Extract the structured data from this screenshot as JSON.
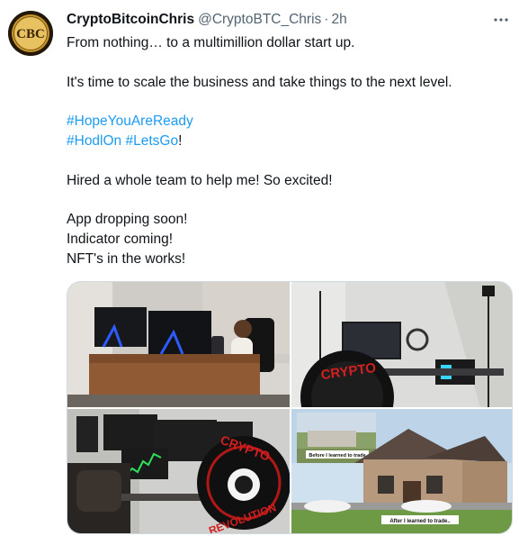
{
  "tweet": {
    "display_name": "CryptoBitcoinChris",
    "handle": "@CryptoBTC_Chris",
    "separator": "·",
    "time": "2h",
    "avatar_text": "CBC",
    "lines": [
      "From nothing… to a multimillion dollar start up.",
      "It's time to scale the business and take things to the next level.",
      "#HopeYouAreReady",
      "#HodlOn",
      "#LetsGo",
      "!",
      "Hired a whole team to help me! So excited!",
      "App dropping soon!",
      "Indicator coming!",
      "NFT's in the works!"
    ]
  },
  "media": {
    "images": [
      {
        "icon": "office-desk-photo"
      },
      {
        "icon": "studio-setup-photo",
        "logo_text": "CRYPTO"
      },
      {
        "icon": "trading-station-photo",
        "logo_top": "CRYPTO",
        "logo_bottom": "REVOLUTION"
      },
      {
        "icon": "house-comparison-photo",
        "caption_before": "Before I learned to trade",
        "caption_after": "After I learned to trade.."
      }
    ]
  },
  "colors": {
    "link": "#1d9bf0",
    "secondary_text": "#536471",
    "border": "#cfd9de"
  }
}
